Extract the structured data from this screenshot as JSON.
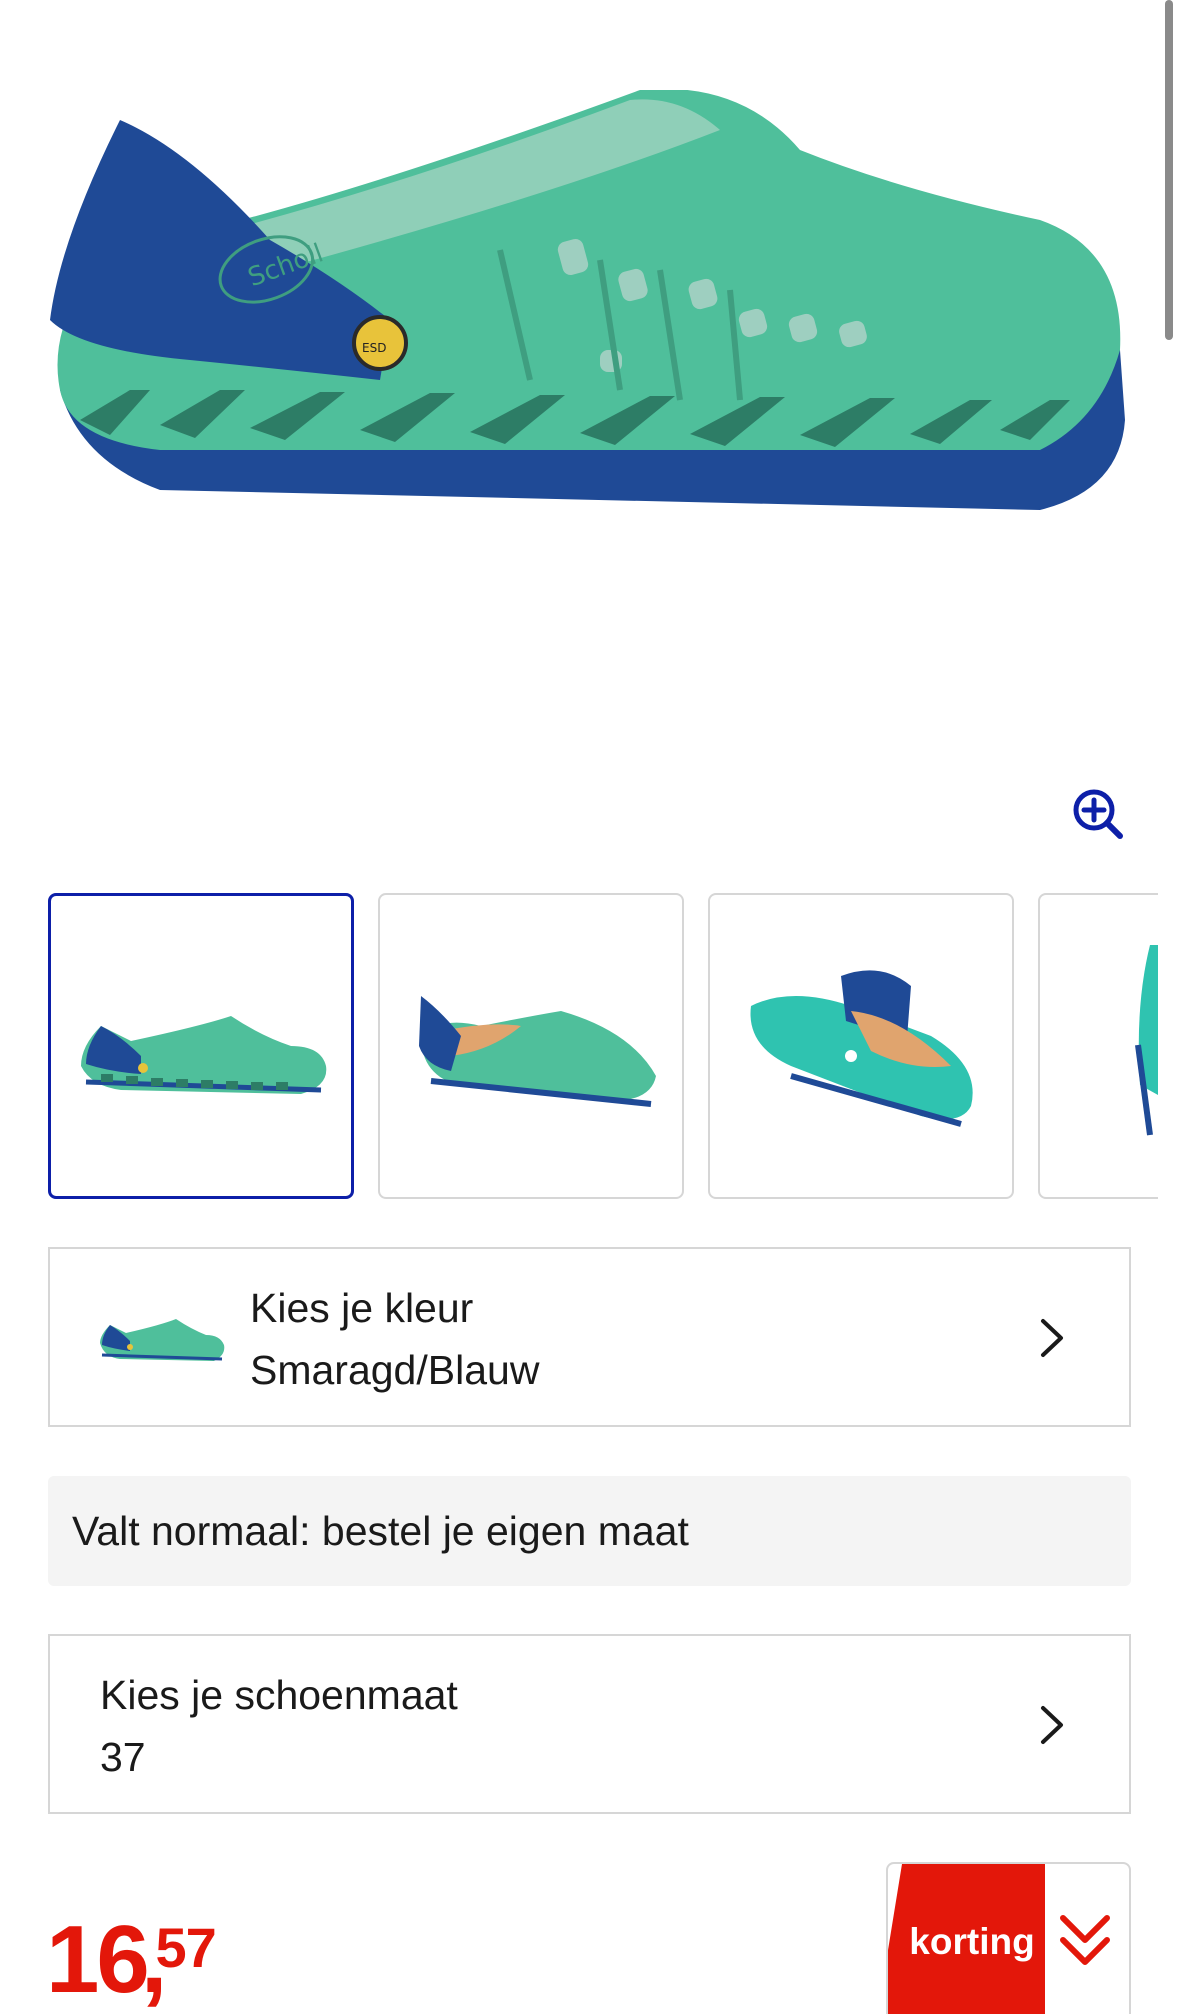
{
  "product": {
    "brand_on_shoe": "Scholl",
    "badge_on_shoe": "ESD",
    "main_image_icon": "shoe-image",
    "zoom_icon": "zoom-in-icon"
  },
  "thumbnails": [
    {
      "icon": "shoe-side-view",
      "selected": true
    },
    {
      "icon": "shoe-front-angle",
      "selected": false
    },
    {
      "icon": "shoe-rear-angle",
      "selected": false
    },
    {
      "icon": "shoe-partial",
      "selected": false
    }
  ],
  "color_selector": {
    "label": "Kies je kleur",
    "value": "Smaragd/Blauw"
  },
  "fit_note": {
    "text": "Valt normaal: bestel je eigen maat"
  },
  "size_selector": {
    "label": "Kies je schoenmaat",
    "value": "37"
  },
  "price": {
    "whole": "16",
    "separator": ",",
    "cents": "57"
  },
  "discount": {
    "label": "korting"
  },
  "colors": {
    "accent_blue": "#0d1fa8",
    "price_red": "#e3170a",
    "shoe_green": "#4fbf9b",
    "shoe_blue": "#1f4a96"
  }
}
